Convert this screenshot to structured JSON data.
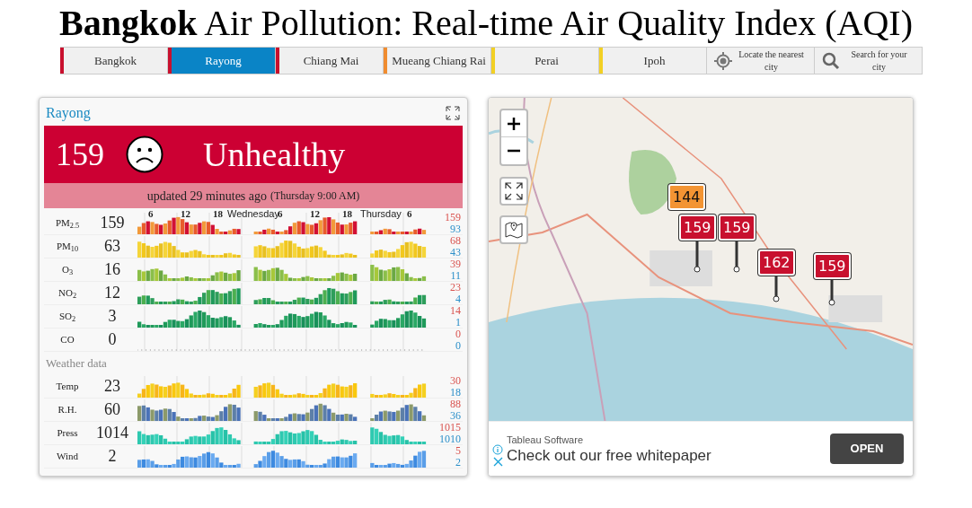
{
  "page_title": "**Bangkok** Air Pollution: Real-time Air Quality Index (AQI)",
  "nav": {
    "tabs": [
      {
        "label": "Bangkok",
        "selected": false,
        "color": "#c8102e"
      },
      {
        "label": "Rayong",
        "selected": true,
        "color": "#c8102e"
      },
      {
        "label": "Chiang Mai",
        "selected": false,
        "color": "#c8102e"
      },
      {
        "label": "Mueang Chiang Rai",
        "selected": false,
        "color": "#f08c30"
      },
      {
        "label": "Perai",
        "selected": false,
        "color": "#f2d024"
      },
      {
        "label": "Ipoh",
        "selected": false,
        "color": "#f2d024"
      }
    ],
    "actions": [
      {
        "kind": "locate",
        "label": "Locate the nearest city"
      },
      {
        "kind": "search",
        "label": "Search for your city"
      }
    ]
  },
  "station": {
    "name": "Rayong",
    "aqi": "159",
    "status": "Unhealthy",
    "updated": "updated 29 minutes ago",
    "updated_time": "(Thursday 9:00 AM)",
    "time_labels": [
      "6",
      "12",
      "18",
      "Wednesday",
      "6",
      "12",
      "18",
      "Thursday",
      "6"
    ],
    "pollutants": [
      {
        "label": "PM$_{2.5}$",
        "value": "159",
        "max": "159",
        "min": "93"
      },
      {
        "label": "PM$_{10}$",
        "value": "63",
        "max": "68",
        "min": "43"
      },
      {
        "label": "O$_{3}$",
        "value": "16",
        "max": "39",
        "min": "11"
      },
      {
        "label": "NO$_{2}$",
        "value": "12",
        "max": "23",
        "min": "4"
      },
      {
        "label": "SO$_{2}$",
        "value": "3",
        "max": "14",
        "min": "1"
      },
      {
        "label": "CO",
        "value": "0",
        "max": "0",
        "min": "0"
      }
    ],
    "weather_heading": "Weather data",
    "weather": [
      {
        "label": "Temp",
        "value": "23",
        "max": "30",
        "min": "18"
      },
      {
        "label": "R.H.",
        "value": "60",
        "max": "88",
        "min": "36"
      },
      {
        "label": "Press",
        "value": "1014",
        "max": "1015",
        "min": "1010"
      },
      {
        "label": "Wind",
        "value": "2",
        "max": "5",
        "min": "2"
      }
    ]
  },
  "map": {
    "markers": [
      {
        "value": "144",
        "color": "#f39433"
      },
      {
        "value": "159",
        "color": "#c8102e"
      },
      {
        "value": "159",
        "color": "#c8102e"
      },
      {
        "value": "162",
        "color": "#c8102e"
      },
      {
        "value": "159",
        "color": "#c8102e"
      }
    ],
    "ad": {
      "advertiser": "Tableau Software",
      "headline": "Check out our free whitepaper",
      "button": "OPEN"
    }
  }
}
